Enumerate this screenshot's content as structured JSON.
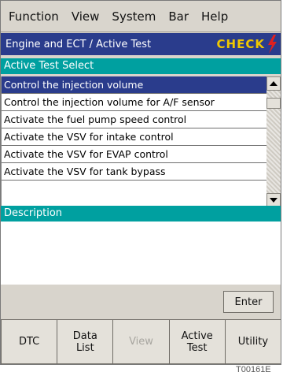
{
  "menu": [
    "Function",
    "View",
    "System",
    "Bar",
    "Help"
  ],
  "header": {
    "title": "Engine and ECT / Active Test",
    "check_label": "CHECK"
  },
  "sections": {
    "list_header": "Active Test Select",
    "desc_header": "Description"
  },
  "tests": [
    "Control the injection volume",
    "Control the injection volume for A/F sensor",
    "Activate the fuel pump speed control",
    "Activate the VSV for intake control",
    "Activate the VSV for EVAP control",
    "Activate the VSV for tank bypass"
  ],
  "selected_index": 0,
  "buttons": {
    "enter": "Enter"
  },
  "bottom": [
    {
      "label": "DTC",
      "enabled": true
    },
    {
      "label": "Data\nList",
      "enabled": true
    },
    {
      "label": "View",
      "enabled": false
    },
    {
      "label": "Active\nTest",
      "enabled": true
    },
    {
      "label": "Utility",
      "enabled": true
    }
  ],
  "figure_code": "T00161E",
  "colors": {
    "title_bar": "#2a3c8c",
    "section_header": "#00a0a0",
    "check": "#f0c800",
    "bolt": "#e02020"
  }
}
